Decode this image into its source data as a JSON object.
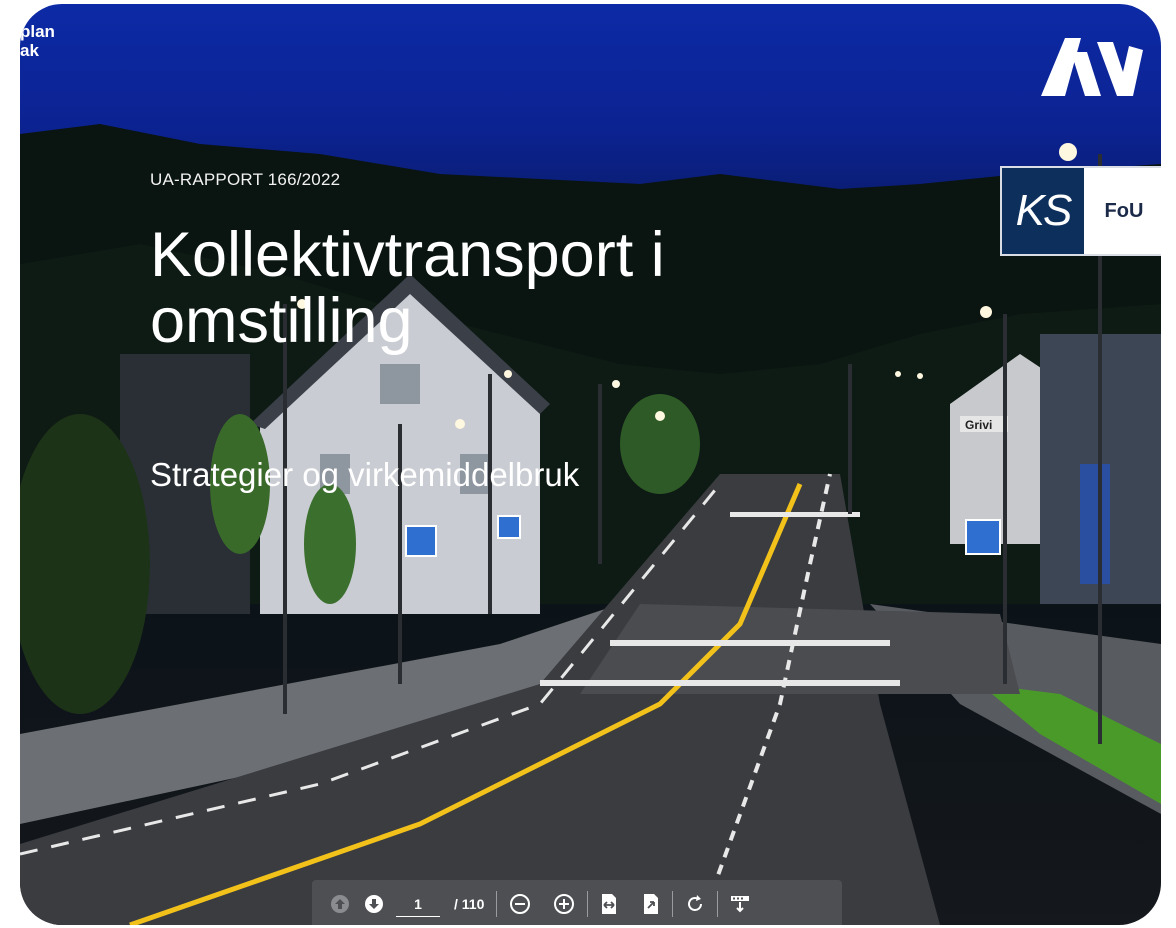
{
  "corner": {
    "line1": "plan",
    "line2": "ak"
  },
  "cover": {
    "report_number": "UA-RAPPORT 166/2022",
    "title_line1": "Kollektivtransport i",
    "title_line2": "omstilling",
    "subtitle": "Strategier og virkemiddelbruk"
  },
  "ks_badge": {
    "left": "KS",
    "right": "FoU"
  },
  "street_sign": "Grivi",
  "toolbar": {
    "page_current": "1",
    "page_total": "/ 110",
    "icons": [
      "arrow-up-icon",
      "arrow-down-icon",
      "zoom-out-icon",
      "zoom-in-icon",
      "fit-width-icon",
      "fit-page-icon",
      "rotate-icon",
      "download-icon"
    ]
  },
  "colors": {
    "sky": "#0b2290",
    "toolbar": "#4d4f53",
    "road_line": "#f2c21a",
    "ks_blue": "#0c2f5c"
  }
}
